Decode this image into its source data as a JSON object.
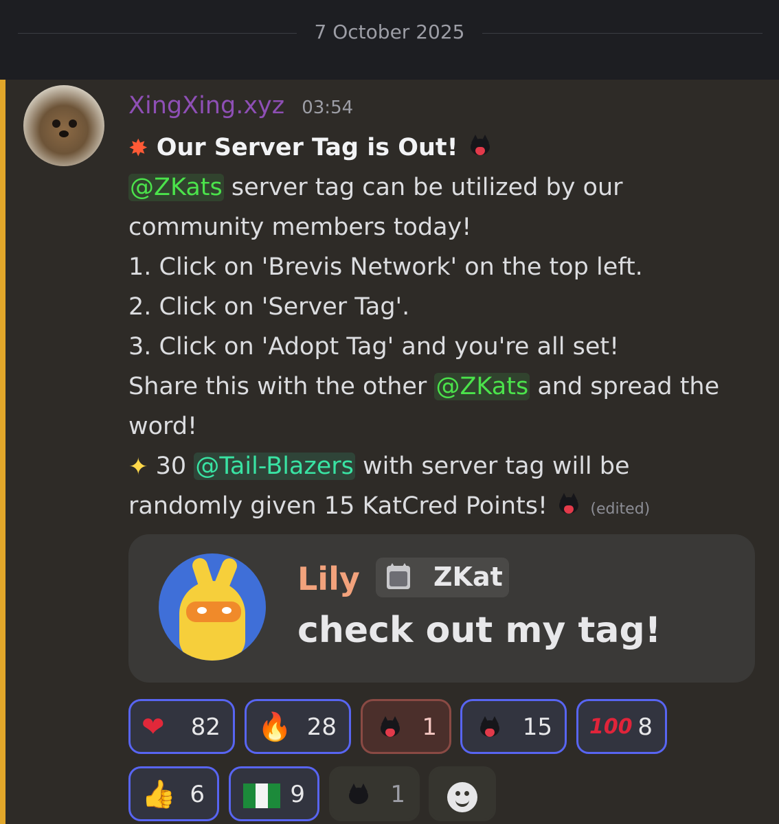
{
  "date_divider": "7 October 2025",
  "message": {
    "username": "XingXing.xyz",
    "timestamp": "03:54",
    "title": "Our Server Tag is Out!",
    "mention_zkats": "@ZKats",
    "mention_tail": "@Tail-Blazers",
    "line_2_rest": "server tag can be utilized by our",
    "line_3": "community members today!",
    "step_1": "1.  Click on 'Brevis Network' on the top left.",
    "step_2": "2.  Click on 'Server Tag'.",
    "step_3": "3.  Click on 'Adopt Tag' and you're all set!",
    "share_pre": "Share this with the other",
    "share_post": "and spread the",
    "word_line": "word!",
    "reward_pre": "30",
    "reward_post": "with server tag will be",
    "reward_line2": "randomly given 15 KatCred Points!",
    "edited": "(edited)"
  },
  "embed": {
    "name": "Lily",
    "tag": "ZKat",
    "text": "check out my tag!"
  },
  "reactions": [
    {
      "emoji": "❤",
      "icon": "heart-icon",
      "count": "82",
      "style": "active"
    },
    {
      "emoji": "🔥",
      "icon": "fire-icon",
      "count": "28",
      "style": "active"
    },
    {
      "emoji": "",
      "icon": "cat-heart-icon",
      "count": "1",
      "style": "red"
    },
    {
      "emoji": "",
      "icon": "cat-heart-icon",
      "count": "15",
      "style": "active"
    },
    {
      "emoji": "100",
      "icon": "hundred-icon",
      "count": "8",
      "style": "active"
    },
    {
      "emoji": "👍",
      "icon": "thumbs-up-icon",
      "count": "6",
      "style": "active"
    },
    {
      "emoji": "",
      "icon": "nigeria-flag-icon",
      "count": "9",
      "style": "active"
    },
    {
      "emoji": "",
      "icon": "black-cat-icon",
      "count": "1",
      "style": "plain"
    }
  ],
  "colors": {
    "username": "#8e4fb5",
    "mention": "#4be34b",
    "mention_teal": "#39e3a3",
    "highlight_bar": "#e2a72a",
    "reaction_border": "#5865f2"
  }
}
